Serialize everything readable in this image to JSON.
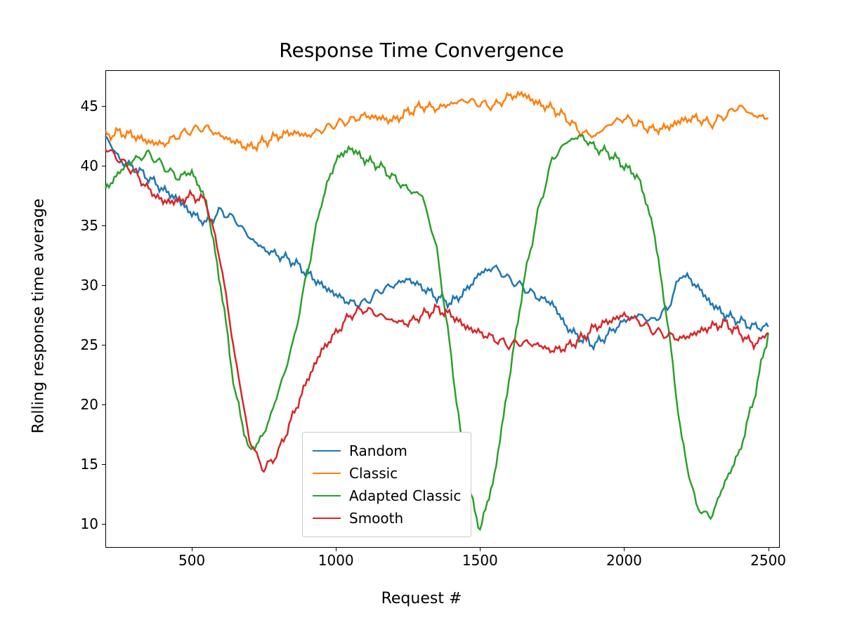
{
  "chart_data": {
    "type": "line",
    "title": "Response Time Convergence",
    "xlabel": "Request #",
    "ylabel": "Rolling response time average",
    "xlim": [
      200,
      2540
    ],
    "ylim": [
      8,
      48
    ],
    "xticks": [
      500,
      1000,
      1500,
      2000,
      2500
    ],
    "yticks": [
      10,
      15,
      20,
      25,
      30,
      35,
      40,
      45
    ],
    "legend_position": "lower-center",
    "series": [
      {
        "name": "Random",
        "color": "#1f77b4",
        "x": [
          200,
          250,
          300,
          350,
          400,
          450,
          500,
          550,
          600,
          650,
          700,
          750,
          800,
          850,
          900,
          950,
          1000,
          1050,
          1100,
          1150,
          1200,
          1250,
          1300,
          1350,
          1400,
          1450,
          1500,
          1550,
          1600,
          1650,
          1700,
          1750,
          1800,
          1850,
          1900,
          1950,
          2000,
          2050,
          2100,
          2150,
          2200,
          2250,
          2300,
          2350,
          2400,
          2450,
          2500
        ],
        "values": [
          42.5,
          40.5,
          39.8,
          39.0,
          38.0,
          37.2,
          36.0,
          35.2,
          36.2,
          35.5,
          34.0,
          33.0,
          32.5,
          32.0,
          31.0,
          30.0,
          29.2,
          28.5,
          28.5,
          29.5,
          30.0,
          30.5,
          29.8,
          29.0,
          28.5,
          29.5,
          31.0,
          31.5,
          30.5,
          29.8,
          29.0,
          28.5,
          26.5,
          25.5,
          25.0,
          26.0,
          27.0,
          27.5,
          27.0,
          28.0,
          31.0,
          30.0,
          28.5,
          27.5,
          27.0,
          26.5,
          26.5
        ]
      },
      {
        "name": "Classic",
        "color": "#ff7f0e",
        "x": [
          200,
          250,
          300,
          350,
          400,
          450,
          500,
          550,
          600,
          650,
          700,
          750,
          800,
          850,
          900,
          950,
          1000,
          1050,
          1100,
          1150,
          1200,
          1250,
          1300,
          1350,
          1400,
          1450,
          1500,
          1550,
          1600,
          1650,
          1700,
          1750,
          1800,
          1850,
          1900,
          1950,
          2000,
          2050,
          2100,
          2150,
          2200,
          2250,
          2300,
          2350,
          2400,
          2450,
          2500
        ],
        "values": [
          42.5,
          42.8,
          42.5,
          42.0,
          41.8,
          42.5,
          43.0,
          43.2,
          42.5,
          42.0,
          41.5,
          42.0,
          42.5,
          42.8,
          42.5,
          43.0,
          43.5,
          43.8,
          44.2,
          44.0,
          43.8,
          44.5,
          45.0,
          44.8,
          45.2,
          45.5,
          45.2,
          45.0,
          45.8,
          46.0,
          45.2,
          44.8,
          44.0,
          42.8,
          42.5,
          43.5,
          44.0,
          43.5,
          43.0,
          43.2,
          43.8,
          44.0,
          43.5,
          44.2,
          45.0,
          44.2,
          44.0
        ]
      },
      {
        "name": "Adapted Classic",
        "color": "#2ca02c",
        "x": [
          200,
          250,
          300,
          350,
          400,
          450,
          500,
          550,
          600,
          650,
          700,
          750,
          800,
          850,
          900,
          950,
          1000,
          1050,
          1100,
          1150,
          1200,
          1250,
          1300,
          1350,
          1400,
          1450,
          1500,
          1550,
          1600,
          1650,
          1700,
          1750,
          1800,
          1850,
          1900,
          1950,
          2000,
          2050,
          2100,
          2150,
          2200,
          2250,
          2300,
          2350,
          2400,
          2450,
          2500
        ],
        "values": [
          38.0,
          39.5,
          40.5,
          41.0,
          40.0,
          39.0,
          39.5,
          37.0,
          30.0,
          21.0,
          16.0,
          17.5,
          21.0,
          25.0,
          31.0,
          37.0,
          40.5,
          41.5,
          40.5,
          40.0,
          39.0,
          38.0,
          37.5,
          33.0,
          24.0,
          14.0,
          9.5,
          14.0,
          22.0,
          30.0,
          36.0,
          40.5,
          42.0,
          42.5,
          41.5,
          41.0,
          40.0,
          39.0,
          35.0,
          27.0,
          17.0,
          11.5,
          10.5,
          13.5,
          16.0,
          20.5,
          26.0
        ]
      },
      {
        "name": "Smooth",
        "color": "#d62728",
        "x": [
          200,
          250,
          300,
          350,
          400,
          450,
          500,
          550,
          600,
          650,
          700,
          750,
          800,
          850,
          900,
          950,
          1000,
          1050,
          1100,
          1150,
          1200,
          1250,
          1300,
          1350,
          1400,
          1450,
          1500,
          1550,
          1600,
          1650,
          1700,
          1750,
          1800,
          1850,
          1900,
          1950,
          2000,
          2050,
          2100,
          2150,
          2200,
          2250,
          2300,
          2350,
          2400,
          2450,
          2500
        ],
        "values": [
          41.5,
          40.5,
          39.5,
          38.0,
          37.0,
          37.0,
          37.5,
          37.0,
          32.0,
          24.0,
          17.0,
          14.5,
          16.0,
          19.0,
          22.0,
          24.5,
          26.0,
          27.5,
          28.0,
          27.5,
          27.0,
          26.8,
          27.5,
          28.0,
          27.5,
          26.5,
          26.0,
          25.5,
          25.0,
          25.2,
          25.0,
          24.5,
          24.8,
          25.5,
          26.5,
          27.0,
          27.5,
          27.0,
          26.2,
          25.8,
          25.5,
          26.0,
          26.5,
          26.8,
          26.0,
          25.0,
          26.0
        ]
      }
    ]
  }
}
